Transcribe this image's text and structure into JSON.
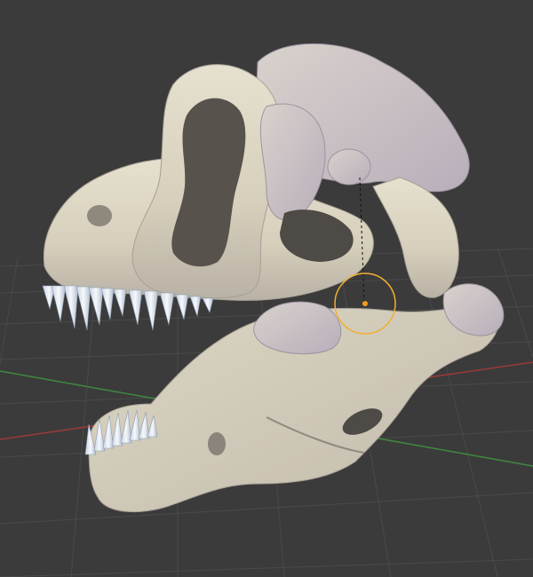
{
  "viewport": {
    "background_color": "#3b3b3b",
    "grid_color": "#4a4a4a",
    "x_axis_color": "#9a3a3a",
    "y_axis_color": "#3f8a3f",
    "object": "t-rex-skull-model",
    "bone_color": "#d9d3c0",
    "bone_shadow_color": "#a9a29a",
    "teeth_color": "#eef2f8",
    "cursor_color": "#f0b030",
    "cursor_type": "3d-cursor"
  }
}
